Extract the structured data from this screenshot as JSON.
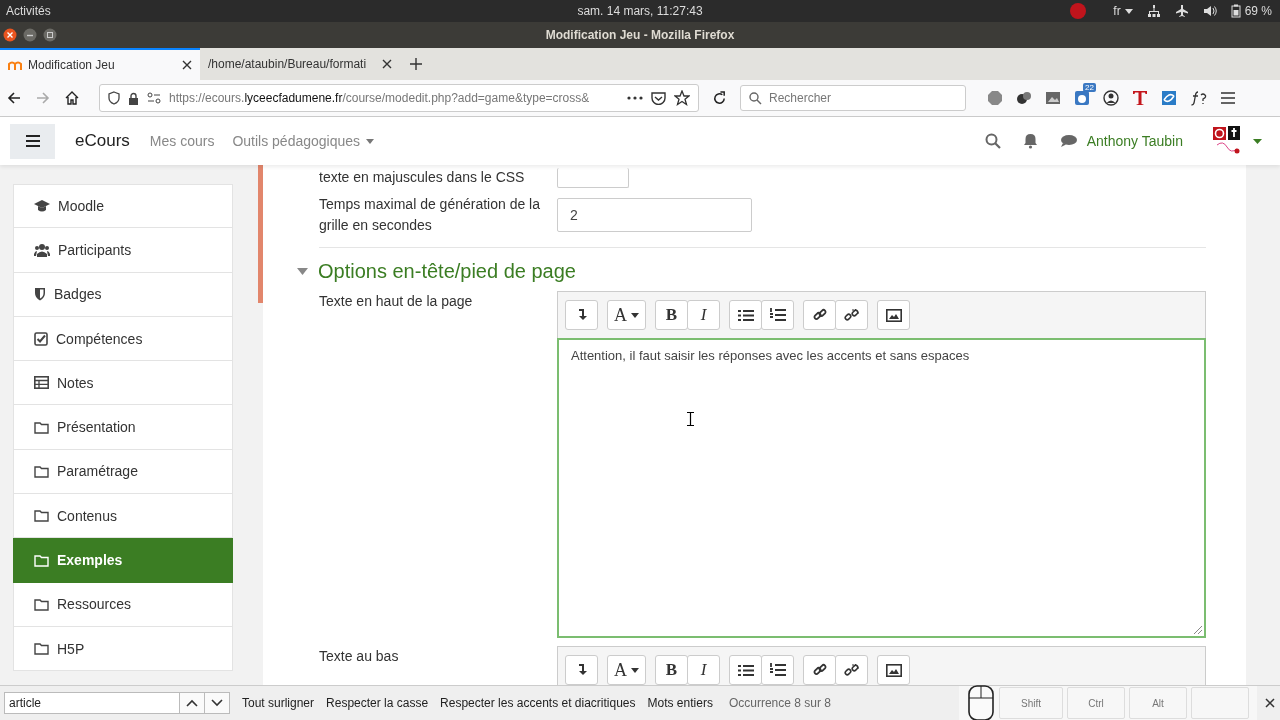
{
  "top_bar": {
    "activities": "Activités",
    "clock": "sam. 14 mars, 11:27:43",
    "language": "fr",
    "battery": "69 %"
  },
  "window": {
    "title": "Modification Jeu - Mozilla Firefox"
  },
  "tabs": [
    {
      "label": "Modification Jeu",
      "selected": true
    },
    {
      "label": "/home/ataubin/Bureau/formati",
      "selected": false
    }
  ],
  "address_bar": {
    "url_pre": "https://ecours.",
    "url_host": "lyceecfadumene.fr",
    "url_post": "/course/modedit.php?add=game&type=cross&",
    "search_placeholder": "Rechercher",
    "extension_badge": "22"
  },
  "site_nav": {
    "brand": "eCours",
    "links": [
      {
        "label": "Mes cours",
        "dropdown": false
      },
      {
        "label": "Outils pédagogiques",
        "dropdown": true
      }
    ],
    "user": "Anthony Taubin"
  },
  "sidebar": {
    "items": [
      {
        "label": "Moodle",
        "kind": "cap",
        "selected": false
      },
      {
        "label": "Participants",
        "kind": "users",
        "selected": false
      },
      {
        "label": "Badges",
        "kind": "shield",
        "selected": false
      },
      {
        "label": "Compétences",
        "kind": "check",
        "selected": false
      },
      {
        "label": "Notes",
        "kind": "table",
        "selected": false
      },
      {
        "label": "Présentation",
        "kind": "folder",
        "selected": false
      },
      {
        "label": "Paramétrage",
        "kind": "folder",
        "selected": false
      },
      {
        "label": "Contenus",
        "kind": "folder",
        "selected": false
      },
      {
        "label": "Exemples",
        "kind": "folder",
        "selected": true
      },
      {
        "label": "Ressources",
        "kind": "folder",
        "selected": false
      },
      {
        "label": "H5P",
        "kind": "folder",
        "selected": false
      }
    ]
  },
  "form": {
    "cut_label": "texte en majuscules dans le CSS",
    "fields": [
      {
        "label": "Temps maximal de génération de la grille en secondes",
        "value": "2"
      }
    ],
    "section": {
      "title": "Options en-tête/pied de page",
      "expanded": true
    },
    "editors": [
      {
        "label": "Texte en haut de la page",
        "content": "Attention, il faut saisir les réponses avec les accents et sans espaces",
        "toolbar": [
          [
            {
              "kind": "collapse"
            }
          ],
          [
            {
              "kind": "font",
              "label": "A"
            }
          ],
          [
            {
              "kind": "bold",
              "label": "B"
            },
            {
              "kind": "italic",
              "label": "I"
            }
          ],
          [
            {
              "kind": "ul"
            },
            {
              "kind": "ol"
            }
          ],
          [
            {
              "kind": "link"
            },
            {
              "kind": "unlink"
            }
          ],
          [
            {
              "kind": "image"
            }
          ]
        ]
      },
      {
        "label": "Texte au bas",
        "toolbar": [
          [
            {
              "kind": "collapse"
            }
          ],
          [
            {
              "kind": "font",
              "label": "A"
            }
          ],
          [
            {
              "kind": "bold",
              "label": "B"
            },
            {
              "kind": "italic",
              "label": "I"
            }
          ],
          [
            {
              "kind": "ul"
            },
            {
              "kind": "ol"
            }
          ],
          [
            {
              "kind": "link"
            },
            {
              "kind": "unlink"
            }
          ],
          [
            {
              "kind": "image"
            }
          ]
        ]
      }
    ]
  },
  "find_bar": {
    "query": "article",
    "options": [
      "Tout surligner",
      "Respecter la casse",
      "Respecter les accents et diacritiques",
      "Mots entiers"
    ],
    "status": "Occurrence 8 sur 8"
  },
  "osk": {
    "keys": [
      "Shift",
      "Ctrl",
      "Alt"
    ]
  }
}
